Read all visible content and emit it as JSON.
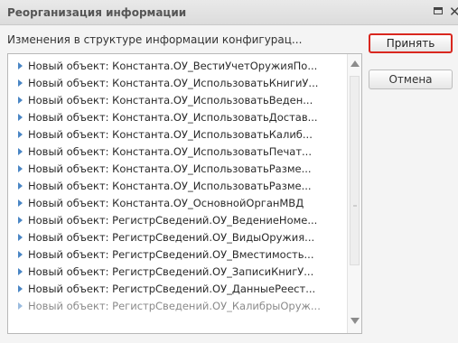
{
  "window": {
    "title": "Реорганизация информации",
    "maximize_icon": "maximize-icon",
    "close_icon": "close-icon",
    "close_glyph": "✕"
  },
  "info": {
    "text": "Изменения в структуре информации конфигурац..."
  },
  "buttons": {
    "accept_label": "Принять",
    "cancel_label": "Отмена",
    "accept_highlight_color": "#d9271f"
  },
  "list": {
    "bullet_icon": "expand-triangle-icon",
    "bullet_color": "#4a86c5",
    "items": [
      "Новый объект: Константа.ОУ_ВестиУчетОружияПо...",
      "Новый объект: Константа.ОУ_ИспользоватьКнигиУ...",
      "Новый объект: Константа.ОУ_ИспользоватьВеден...",
      "Новый объект: Константа.ОУ_ИспользоватьДостав...",
      "Новый объект: Константа.ОУ_ИспользоватьКалиб...",
      "Новый объект: Константа.ОУ_ИспользоватьПечат...",
      "Новый объект: Константа.ОУ_ИспользоватьРазме...",
      "Новый объект: Константа.ОУ_ИспользоватьРазме...",
      "Новый объект: Константа.ОУ_ОсновнойОрганМВД",
      "Новый объект: РегистрСведений.ОУ_ВедениеНоме...",
      "Новый объект: РегистрСведений.ОУ_ВидыОружия...",
      "Новый объект: РегистрСведений.ОУ_Вместимость...",
      "Новый объект: РегистрСведений.ОУ_ЗаписиКнигУ...",
      "Новый объект: РегистрСведений.ОУ_ДанныеРеест...",
      "Новый объект: РегистрСведений.ОУ_КалибрыОруж..."
    ]
  }
}
